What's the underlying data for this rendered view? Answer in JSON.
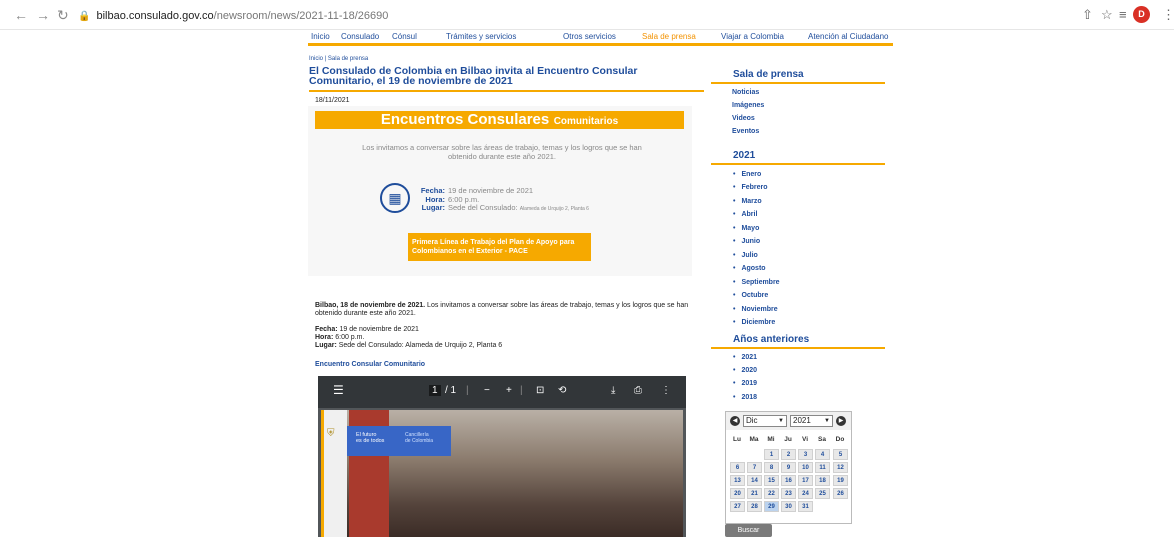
{
  "browser": {
    "url_host": "bilbao.consulado.gov.co",
    "url_path": "/newsroom/news/2021-11-18/26690",
    "profile_initial": "D"
  },
  "nav": {
    "items": [
      "Inicio",
      "Consulado",
      "Cónsul",
      "Trámites y servicios",
      "Otros servicios",
      "Sala de prensa",
      "Viajar a Colombia",
      "Atención al Ciudadano"
    ],
    "active": "Sala de prensa"
  },
  "article": {
    "breadcrumb": "Inicio | Sala de prensa",
    "title": "El Consulado de Colombia en Bilbao invita al Encuentro Consular Comunitario, el 19 de noviembre de 2021",
    "date": "18/11/2021",
    "banner": {
      "title": "Encuentros Consulares",
      "title_small": "Comunitarios",
      "intro": "Los invitamos a conversar sobre las áreas de trabajo, temas y los logros que se han obtenido durante este año 2021.",
      "fecha_label": "Fecha:",
      "fecha": "19 de noviembre de 2021",
      "hora_label": "Hora:",
      "hora": "6:00 p.m.",
      "lugar_label": "Lugar:",
      "lugar": "Sede del Consulado:",
      "lugar_small": "Alameda de Urquijo 2, Planta 6",
      "pace": "Primera Línea de Trabajo del Plan de Apoyo para Colombianos en el Exterior - PACE"
    },
    "lead_bold": "Bilbao, 18 de noviembre de 2021.",
    "lead": " Los invitamos a conversar sobre las áreas de trabajo, temas y los logros que se han obtenido durante este año 2021.",
    "fecha_label": "Fecha:",
    "fecha": " 19 de noviembre de 2021",
    "hora_label": "Hora:",
    "hora": " 6:00 p.m.",
    "lugar_label": "Lugar:",
    "lugar": " Sede del Consulado: Alameda de Urquijo 2, Planta 6",
    "link": "Encuentro Consular Comunitario"
  },
  "pdf": {
    "page_current": "1",
    "page_total": "/ 1",
    "logo_text": "El futuro\nes de todos",
    "logo_text2": "Cancillería\nde Colombia"
  },
  "sidebar": {
    "heading": "Sala de prensa",
    "links": [
      "Noticias",
      "Imágenes",
      "Videos",
      "Eventos"
    ],
    "year_heading": "2021",
    "months": [
      "Enero",
      "Febrero",
      "Marzo",
      "Abril",
      "Mayo",
      "Junio",
      "Julio",
      "Agosto",
      "Septiembre",
      "Octubre",
      "Noviembre",
      "Diciembre"
    ],
    "prev_heading": "Años anteriores",
    "years": [
      "2021",
      "2020",
      "2019",
      "2018"
    ]
  },
  "calendar": {
    "month": "Dic",
    "year": "2021",
    "weekdays": [
      "Lu",
      "Ma",
      "Mi",
      "Ju",
      "Vi",
      "Sa",
      "Do"
    ],
    "days": [
      "1",
      "2",
      "3",
      "4",
      "5",
      "6",
      "7",
      "8",
      "9",
      "10",
      "11",
      "12",
      "13",
      "14",
      "15",
      "16",
      "17",
      "18",
      "19",
      "20",
      "21",
      "22",
      "23",
      "24",
      "25",
      "26",
      "27",
      "28",
      "29",
      "30",
      "31"
    ],
    "selected_day": "29",
    "search_label": "Buscar"
  },
  "colors": {
    "accent": "#f6a900",
    "link": "#1f4d9b"
  }
}
